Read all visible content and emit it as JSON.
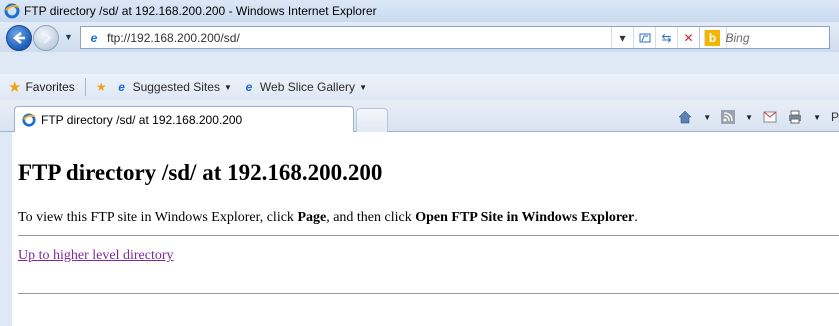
{
  "window": {
    "title": "FTP directory /sd/ at 192.168.200.200 - Windows Internet Explorer"
  },
  "navigation": {
    "address": "ftp://192.168.200.200/sd/",
    "search_placeholder": "Bing"
  },
  "favorites_bar": {
    "favorites_label": "Favorites",
    "items": [
      {
        "label": "Suggested Sites"
      },
      {
        "label": "Web Slice Gallery"
      }
    ]
  },
  "tabs": {
    "active_tab_title": "FTP directory /sd/ at 192.168.200.200"
  },
  "page": {
    "heading": "FTP directory /sd/ at 192.168.200.200",
    "note_prefix": "To view this FTP site in Windows Explorer, click ",
    "note_bold1": "Page",
    "note_mid": ", and then click ",
    "note_bold2": "Open FTP Site in Windows Explorer",
    "note_suffix": ".",
    "up_link": "Up to higher level directory"
  }
}
